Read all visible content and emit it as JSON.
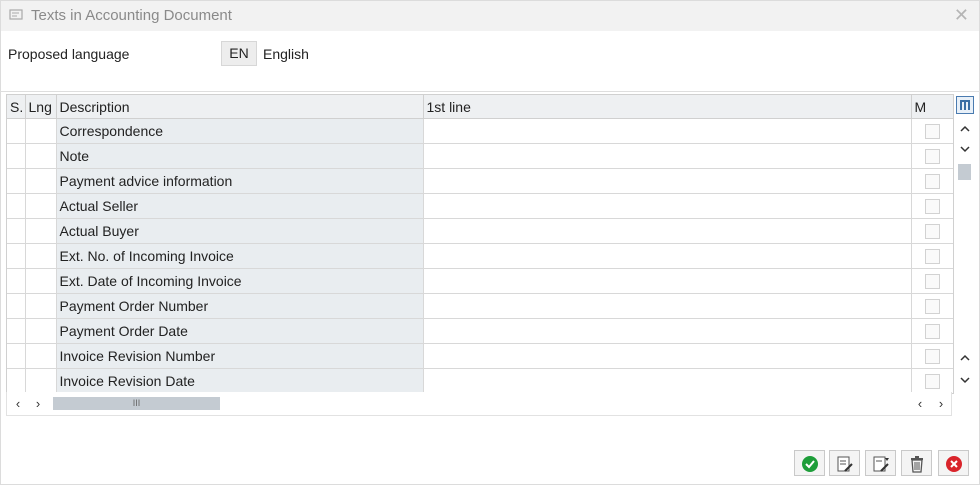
{
  "window": {
    "title": "Texts in Accounting Document",
    "close_glyph": "✕"
  },
  "header": {
    "proposed_language_label": "Proposed language",
    "language_code": "EN",
    "language_name": "English"
  },
  "table": {
    "columns": [
      "S.",
      "Lng",
      "Description",
      "1st line",
      "M"
    ],
    "rows": [
      {
        "s": "",
        "lng": "",
        "description": "Correspondence",
        "line1": "",
        "m": false
      },
      {
        "s": "",
        "lng": "",
        "description": "Note",
        "line1": "",
        "m": false
      },
      {
        "s": "",
        "lng": "",
        "description": "Payment advice information",
        "line1": "",
        "m": false
      },
      {
        "s": "",
        "lng": "",
        "description": "Actual Seller",
        "line1": "",
        "m": false
      },
      {
        "s": "",
        "lng": "",
        "description": "Actual Buyer",
        "line1": "",
        "m": false
      },
      {
        "s": "",
        "lng": "",
        "description": "Ext. No. of Incoming Invoice",
        "line1": "",
        "m": false
      },
      {
        "s": "",
        "lng": "",
        "description": "Ext. Date of Incoming Invoice",
        "line1": "",
        "m": false
      },
      {
        "s": "",
        "lng": "",
        "description": "Payment Order Number",
        "line1": "",
        "m": false
      },
      {
        "s": "",
        "lng": "",
        "description": "Payment Order Date",
        "line1": "",
        "m": false
      },
      {
        "s": "",
        "lng": "",
        "description": "Invoice Revision Number",
        "line1": "",
        "m": false
      },
      {
        "s": "",
        "lng": "",
        "description": "Invoice Revision Date",
        "line1": "",
        "m": false
      }
    ]
  },
  "scroll": {
    "up": "⌃",
    "down": "⌄",
    "left": "‹",
    "right": "›",
    "thumb_grip": "III"
  },
  "icons": {
    "title": "form-icon",
    "column_settings": "column-settings-icon",
    "confirm": "checkmark-icon",
    "edit": "edit-text-icon",
    "edit_more": "edit-text-more-icon",
    "delete": "trash-icon",
    "cancel": "cancel-icon"
  },
  "colors": {
    "confirm": "#1e9e3a",
    "cancel": "#d9242b",
    "description_bg": "#e9edf0",
    "header_bg": "#eef0f2"
  }
}
